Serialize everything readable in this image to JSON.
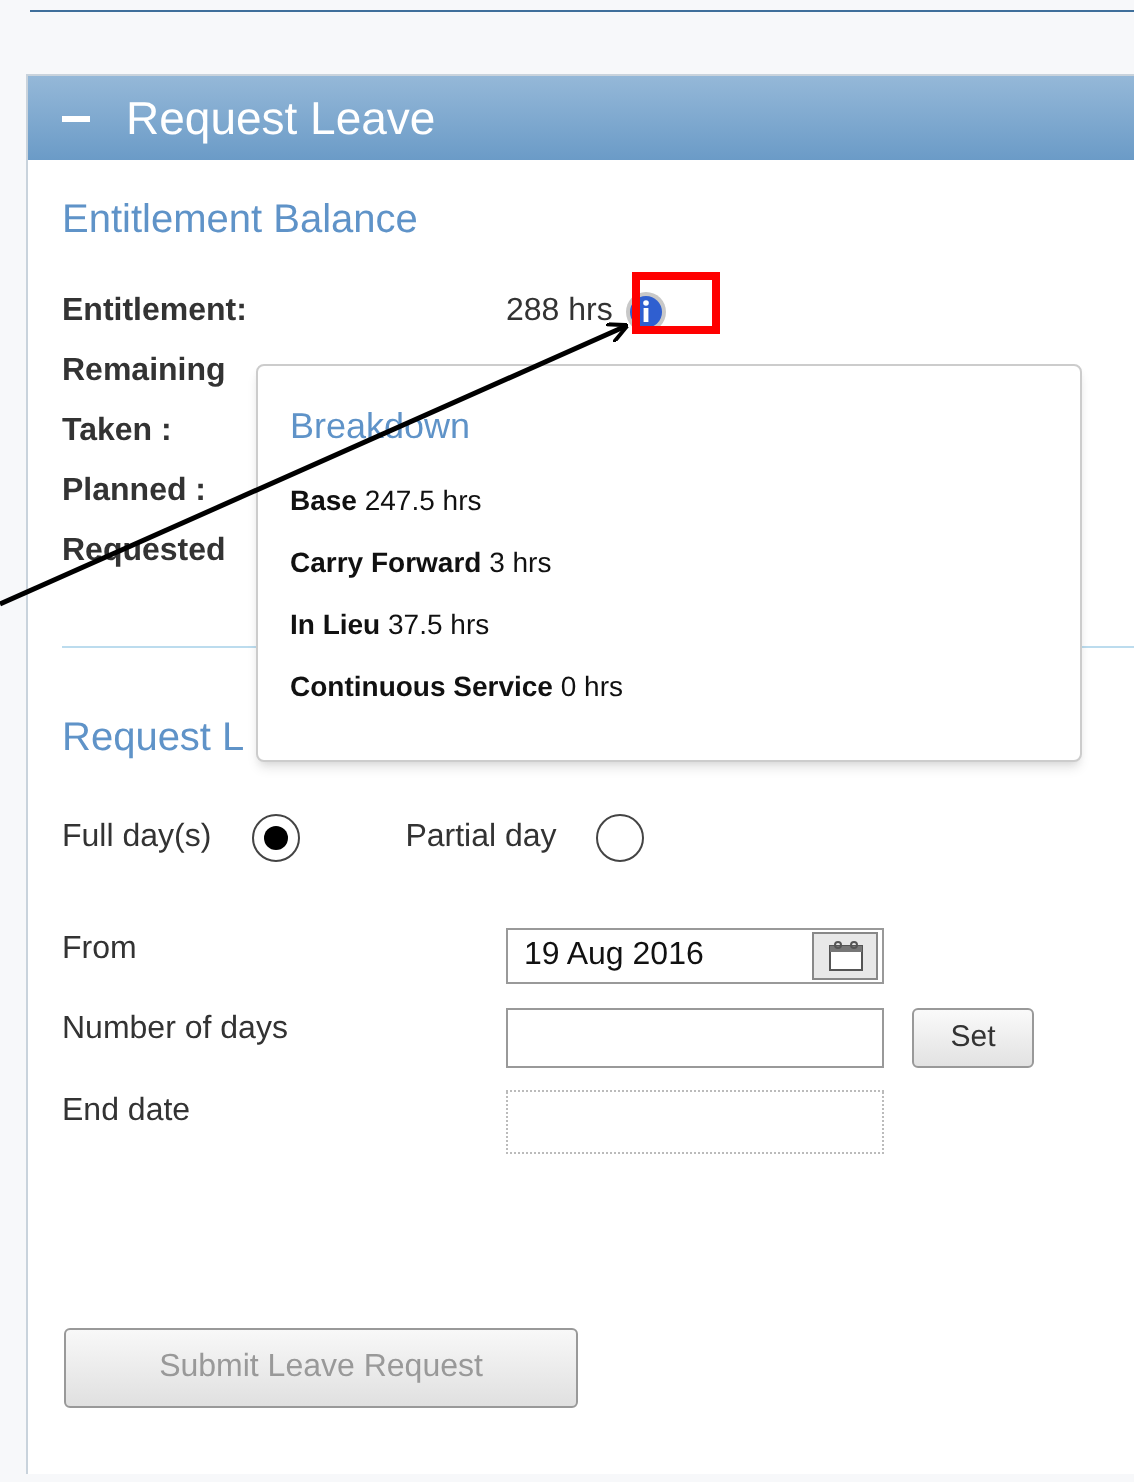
{
  "panel": {
    "title": "Request Leave",
    "expanded": true
  },
  "balance": {
    "heading": "Entitlement Balance",
    "rows": [
      {
        "label": "Entitlement:",
        "value": "288 hrs",
        "info": true
      },
      {
        "label": "Remaining"
      },
      {
        "label": "Taken :"
      },
      {
        "label": "Planned :"
      },
      {
        "label": "Requested"
      }
    ]
  },
  "breakdown_popup": {
    "title": "Breakdown",
    "items": [
      "**Base** 247.5 hrs",
      "**Carry Forward** 3 hrs",
      "**In Lieu** 37.5 hrs",
      "**Continuous Service** 0 hrs"
    ]
  },
  "request": {
    "heading": "Request L",
    "day_options": [
      {
        "label": "Full day(s)",
        "selected": true
      },
      {
        "label": "Partial day",
        "selected": false
      }
    ],
    "from": {
      "label": "From",
      "value": "19 Aug 2016"
    },
    "days": {
      "label": "Number of days",
      "button": "Set"
    },
    "end_date": {
      "label": "End date"
    },
    "submit": {
      "label": "Submit Leave Request",
      "disabled": true
    }
  }
}
